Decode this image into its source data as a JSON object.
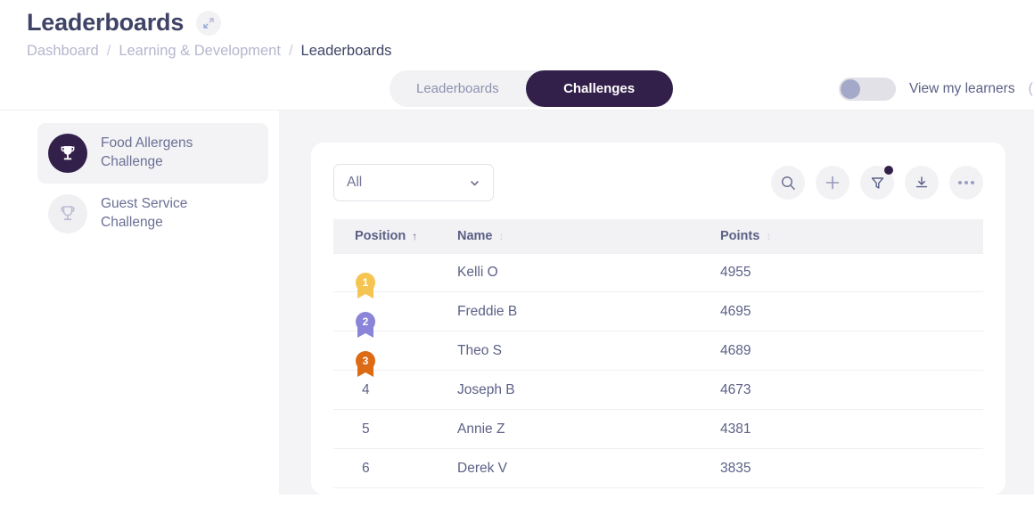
{
  "header": {
    "title": "Leaderboards",
    "expand_icon": "expand-arrows-icon",
    "breadcrumb": [
      {
        "label": "Dashboard",
        "current": false
      },
      {
        "label": "Learning & Development",
        "current": false
      },
      {
        "label": "Leaderboards",
        "current": true
      }
    ],
    "separator": "/"
  },
  "tabs": [
    {
      "label": "Leaderboards",
      "active": false
    },
    {
      "label": "Challenges",
      "active": true
    }
  ],
  "toggle": {
    "label": "View my learners",
    "state": "off",
    "truncated_text": "("
  },
  "sidebar": {
    "items": [
      {
        "label_line1": "Food Allergens",
        "label_line2": "Challenge",
        "icon": "trophy-icon",
        "active": true
      },
      {
        "label_line1": "Guest Service",
        "label_line2": "Challenge",
        "icon": "trophy-icon",
        "active": false
      }
    ]
  },
  "toolbar": {
    "filter_select": {
      "value": "All",
      "chevron": "chevron-down-icon"
    },
    "actions": [
      {
        "name": "search-icon",
        "badge": false
      },
      {
        "name": "plus-icon",
        "badge": false
      },
      {
        "name": "filter-icon",
        "badge": true
      },
      {
        "name": "download-icon",
        "badge": false
      },
      {
        "name": "more-options-icon",
        "badge": false
      }
    ]
  },
  "table": {
    "columns": [
      {
        "label": "Position",
        "sort": "asc"
      },
      {
        "label": "Name",
        "sort": "none"
      },
      {
        "label": "Points",
        "sort": "none"
      }
    ],
    "rows": [
      {
        "position": "1",
        "medal": "gold",
        "name": "Kelli O",
        "points": "4955"
      },
      {
        "position": "2",
        "medal": "silver",
        "name": "Freddie B",
        "points": "4695"
      },
      {
        "position": "3",
        "medal": "bronze",
        "name": "Theo S",
        "points": "4689"
      },
      {
        "position": "4",
        "medal": null,
        "name": "Joseph B",
        "points": "4673"
      },
      {
        "position": "5",
        "medal": null,
        "name": "Annie Z",
        "points": "4381"
      },
      {
        "position": "6",
        "medal": null,
        "name": "Derek V",
        "points": "3835"
      }
    ]
  },
  "colors": {
    "brand_dark": "#33204a",
    "gold": "#f5c451",
    "silver": "#8b85d9",
    "bronze": "#dd6b15",
    "text": "#5d6186",
    "muted": "#b4b7cd",
    "panel_bg": "#f4f4f6"
  }
}
